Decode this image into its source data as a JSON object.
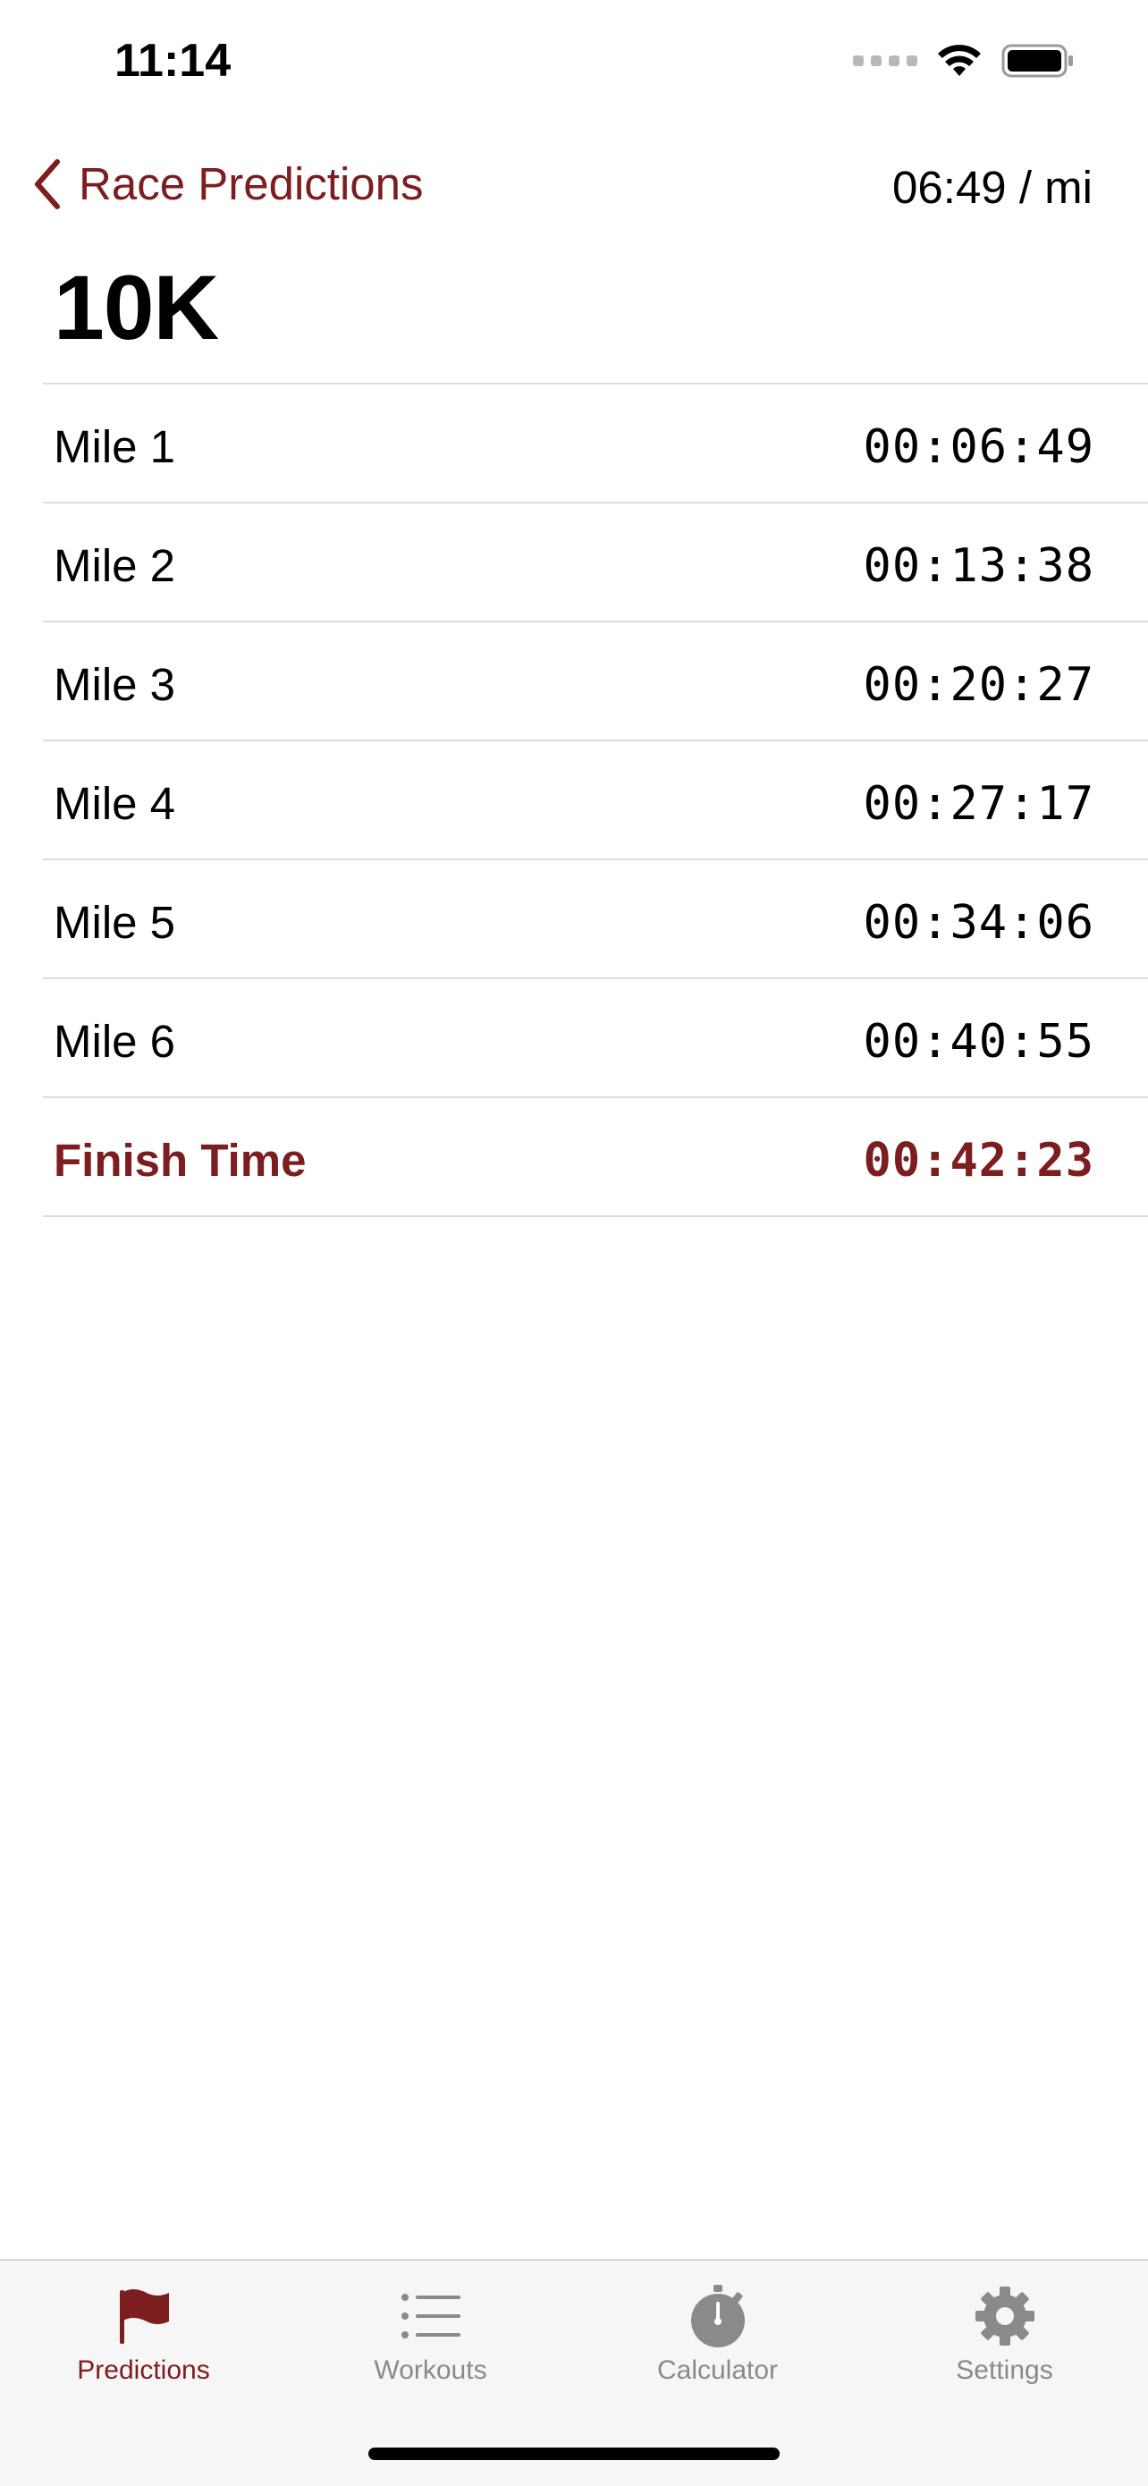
{
  "status_bar": {
    "time": "11:14"
  },
  "nav": {
    "back_label": "Race Predictions",
    "pace": "06:49 / mi"
  },
  "title": "10K",
  "splits": [
    {
      "label": "Mile 1",
      "time": "00:06:49"
    },
    {
      "label": "Mile 2",
      "time": "00:13:38"
    },
    {
      "label": "Mile 3",
      "time": "00:20:27"
    },
    {
      "label": "Mile 4",
      "time": "00:27:17"
    },
    {
      "label": "Mile 5",
      "time": "00:34:06"
    },
    {
      "label": "Mile 6",
      "time": "00:40:55"
    }
  ],
  "finish": {
    "label": "Finish Time",
    "time": "00:42:23"
  },
  "tabs": [
    {
      "label": "Predictions",
      "icon": "flag-icon",
      "active": true
    },
    {
      "label": "Workouts",
      "icon": "list-icon",
      "active": false
    },
    {
      "label": "Calculator",
      "icon": "stopwatch-icon",
      "active": false
    },
    {
      "label": "Settings",
      "icon": "gear-icon",
      "active": false
    }
  ],
  "colors": {
    "accent": "#7c1d20",
    "inactive_tab": "#8a8a8a",
    "separator": "#dcdcdc",
    "tab_bar_bg": "#f6f6f6"
  }
}
